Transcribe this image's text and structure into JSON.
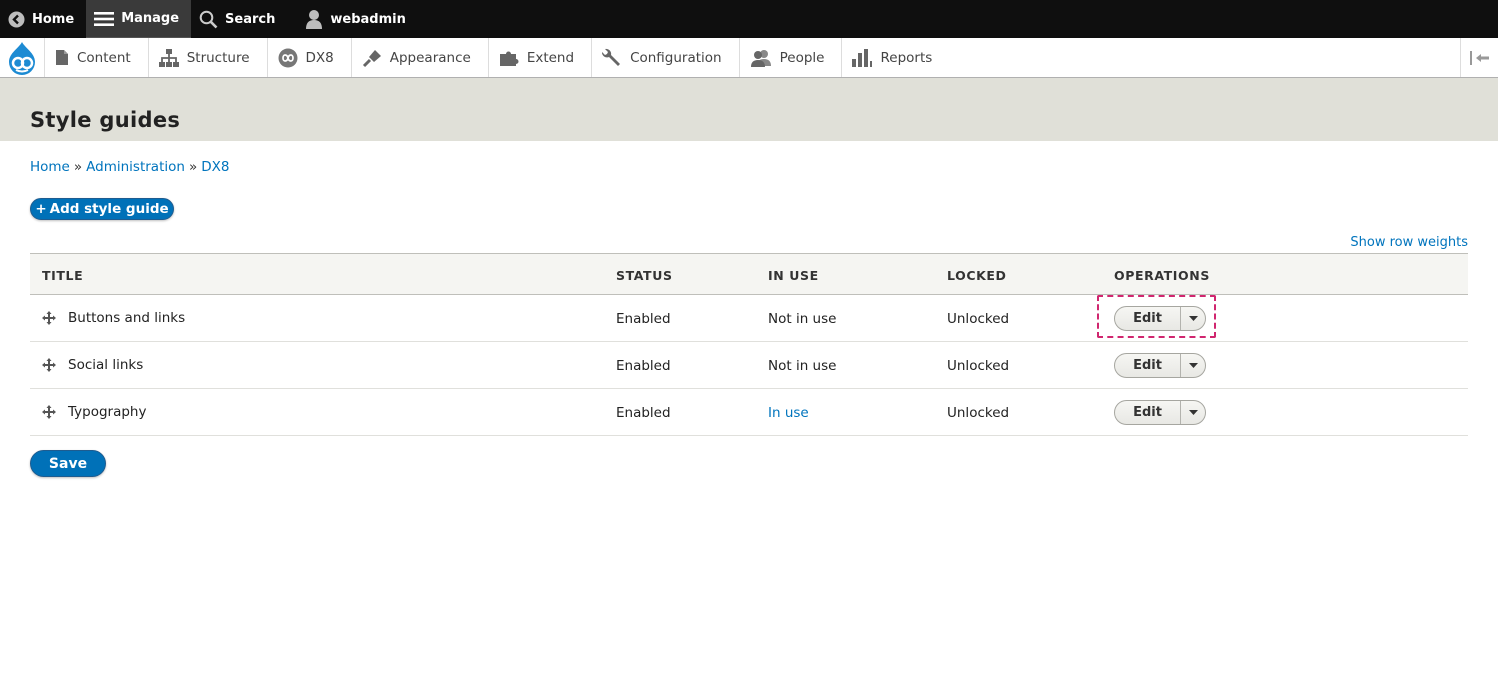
{
  "toolbar": {
    "home": "Home",
    "manage": "Manage",
    "search": "Search",
    "user": "webadmin"
  },
  "menu": {
    "items": [
      {
        "label": "Content",
        "icon": "page-icon"
      },
      {
        "label": "Structure",
        "icon": "hierarchy-icon"
      },
      {
        "label": "DX8",
        "icon": "infinity-icon"
      },
      {
        "label": "Appearance",
        "icon": "paintbrush-icon"
      },
      {
        "label": "Extend",
        "icon": "puzzle-icon"
      },
      {
        "label": "Configuration",
        "icon": "wrench-icon"
      },
      {
        "label": "People",
        "icon": "people-icon"
      },
      {
        "label": "Reports",
        "icon": "bar-chart-icon"
      }
    ]
  },
  "page": {
    "title": "Style guides",
    "breadcrumb": [
      "Home",
      "Administration",
      "DX8"
    ],
    "breadcrumb_sep": "»",
    "add_button": "Add style guide",
    "add_button_plus": "+",
    "row_weights_link": "Show row weights",
    "save_button": "Save"
  },
  "table": {
    "headers": [
      "TITLE",
      "STATUS",
      "IN USE",
      "LOCKED",
      "OPERATIONS"
    ],
    "rows": [
      {
        "title": "Buttons and links",
        "status": "Enabled",
        "in_use": "Not in use",
        "locked": "Unlocked",
        "op": "Edit"
      },
      {
        "title": "Social links",
        "status": "Enabled",
        "in_use": "Not in use",
        "locked": "Unlocked",
        "op": "Edit"
      },
      {
        "title": "Typography",
        "status": "Enabled",
        "in_use": "In use",
        "locked": "Unlocked",
        "op": "Edit"
      }
    ]
  },
  "colors": {
    "link": "#0074bd",
    "primary_button": "#0071b8",
    "highlight": "#d0266f",
    "toolbar_bg": "#0f0f0f",
    "header_bg": "#e0e0d8"
  }
}
